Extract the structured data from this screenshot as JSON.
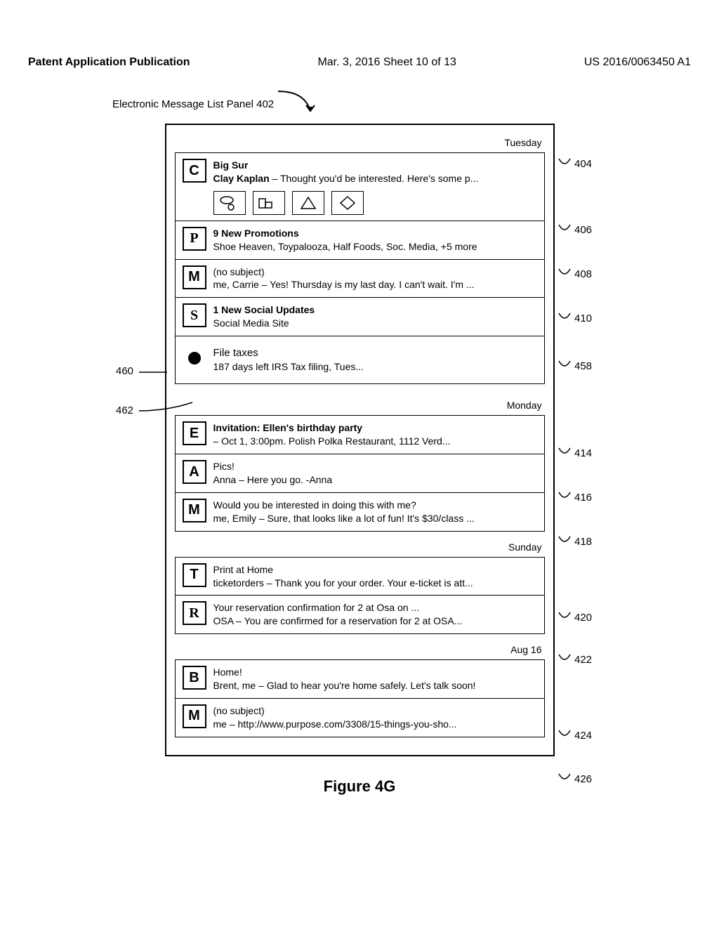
{
  "header": {
    "left": "Patent Application Publication",
    "center": "Mar. 3, 2016  Sheet 10 of 13",
    "right": "US 2016/0063450 A1"
  },
  "panel_label": "Electronic Message List Panel 402",
  "figure_caption": "Figure 4G",
  "side_labels": {
    "l404": "404",
    "l406": "406",
    "l408": "408",
    "l410": "410",
    "l458": "458",
    "l460": "460",
    "l462": "462",
    "l414": "414",
    "l416": "416",
    "l418": "418",
    "l420": "420",
    "l422": "422",
    "l424": "424",
    "l426": "426"
  },
  "days": {
    "tuesday": "Tuesday",
    "monday": "Monday",
    "sunday": "Sunday",
    "aug16": "Aug 16"
  },
  "messages": {
    "m404": {
      "avatar": "C",
      "subject": "Big Sur",
      "sender": "Clay Kaplan",
      "preview": " – Thought you'd be interested. Here's some p..."
    },
    "m406": {
      "avatar": "P",
      "subject": "9 New Promotions",
      "preview": "Shoe Heaven, Toypalooza, Half Foods, Soc. Media, +5 more"
    },
    "m408": {
      "avatar": "M",
      "subject": "(no subject)",
      "preview": "me, Carrie – Yes! Thursday is my last day. I can't wait. I'm ..."
    },
    "m410": {
      "avatar": "S",
      "subject": "1 New Social Updates",
      "preview": "Social Media Site"
    },
    "m458": {
      "subject": "File taxes",
      "preview": "187 days left IRS Tax filing, Tues..."
    },
    "m414": {
      "avatar": "E",
      "subject": "Invitation: Ellen's birthday party",
      "preview": "– Oct 1, 3:00pm. Polish Polka Restaurant, 1112 Verd..."
    },
    "m416": {
      "avatar": "A",
      "subject": "Pics!",
      "preview": "Anna – Here you go. -Anna"
    },
    "m418": {
      "avatar": "M",
      "subject": "Would you be interested in doing this with me?",
      "preview": "me, Emily – Sure, that looks like a lot of fun! It's $30/class ..."
    },
    "m420": {
      "avatar": "T",
      "subject": "Print at Home",
      "preview": "ticketorders – Thank you for your order. Your e-ticket is att..."
    },
    "m422": {
      "avatar": "R",
      "subject": "Your reservation confirmation for 2 at Osa on ...",
      "preview": "OSA – You are confirmed for a reservation for 2 at OSA..."
    },
    "m424": {
      "avatar": "B",
      "subject": "Home!",
      "preview": "Brent, me – Glad to hear you're home safely. Let's talk soon!"
    },
    "m426": {
      "avatar": "M",
      "subject": "(no subject)",
      "preview": "me – http://www.purpose.com/3308/15-things-you-sho..."
    }
  }
}
